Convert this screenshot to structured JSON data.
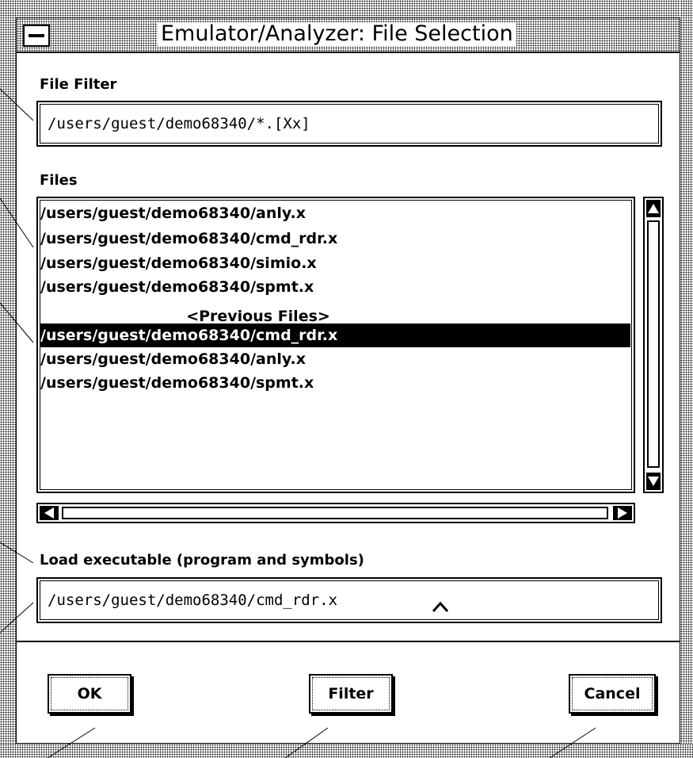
{
  "window": {
    "title": "Emulator/Analyzer: File Selection"
  },
  "file_filter": {
    "label": "File Filter",
    "value": "/users/guest/demo68340/*.[Xx]"
  },
  "files": {
    "label": "Files",
    "items": [
      "/users/guest/demo68340/anly.x",
      "/users/guest/demo68340/cmd_rdr.x",
      "/users/guest/demo68340/simio.x",
      "/users/guest/demo68340/spmt.x"
    ],
    "previous_label": "<Previous Files>",
    "previous_items": [
      "/users/guest/demo68340/cmd_rdr.x",
      "/users/guest/demo68340/anly.x",
      "/users/guest/demo68340/spmt.x"
    ],
    "selected_previous_index": 0
  },
  "selection": {
    "label": "Load executable (program and symbols)",
    "value": "/users/guest/demo68340/cmd_rdr.x"
  },
  "buttons": {
    "ok": "OK",
    "filter": "Filter",
    "cancel": "Cancel"
  },
  "icons": {
    "window_menu": "window-menu-icon",
    "scroll_up": "arrow-up-icon",
    "scroll_down": "arrow-down-icon",
    "scroll_left": "arrow-left-icon",
    "scroll_right": "arrow-right-icon",
    "text_cursor": "text-cursor-icon"
  },
  "colors": {
    "background": "#ffffff",
    "foreground": "#000000",
    "selection_bg": "#000000",
    "selection_fg": "#ffffff"
  }
}
